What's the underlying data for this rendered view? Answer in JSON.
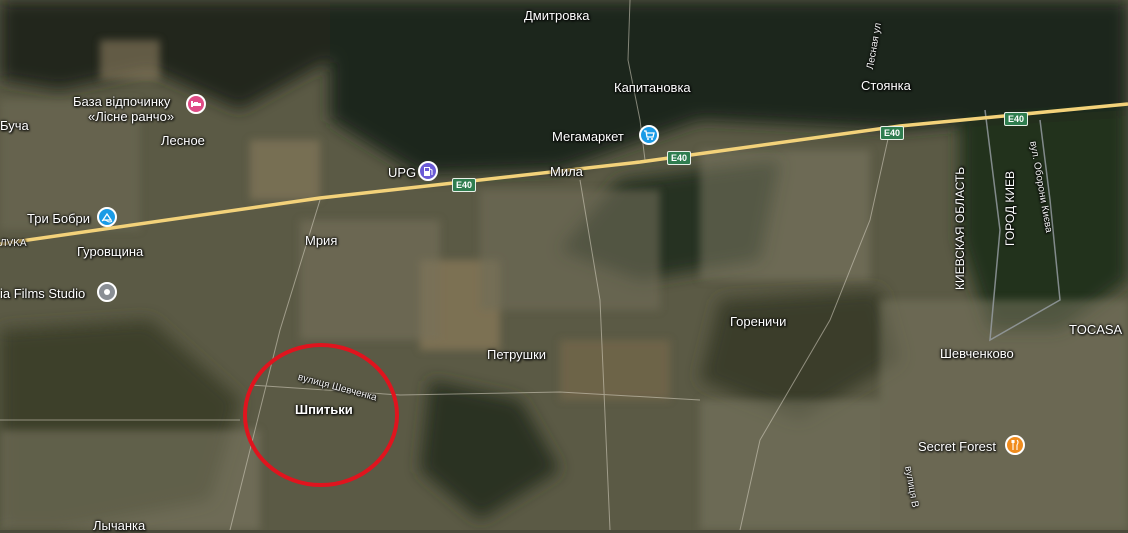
{
  "places": {
    "dmytrivka": "Дмитровка",
    "kapitanovka": "Капитановка",
    "stoyanka": "Стоянка",
    "mila": "Мила",
    "lisne": "Лесное",
    "gurovshchina": "Гуровщина",
    "mriya": "Мрия",
    "petrushki": "Петрушки",
    "gorenichi": "Гореничи",
    "shevchenkovo": "Шевченково",
    "shpitki": "Шпитьки",
    "lichanka": "Лычанка",
    "bucha_partial": "Буча",
    "tocasa": "TOCASA",
    "kiev_oblast": "КИЕВСКАЯ ОБЛАСТЬ",
    "kiev_city": "ГОРОД КИЕВ"
  },
  "pois": {
    "lisne_rancho_line1": "База відпочинку",
    "lisne_rancho_line2": "«Лісне ранчо»",
    "upg": "UPG",
    "megamarket": "Мегамаркет",
    "tri_bobri": "Три Бобри",
    "films_studio": "ia Films Studio",
    "secret_forest": "Secret Forest"
  },
  "roads": {
    "e40_1": "E40",
    "e40_2": "E40",
    "e40_3": "E40",
    "e40_4": "E40",
    "shevchenka": "вулиця Шевченка",
    "lisna": "Лесная ул",
    "oborony": "вул. Оборони Києва",
    "lesi": "вулиця В",
    "edge_left": "ЛVKA"
  },
  "colors": {
    "highway": "#f3d27a",
    "highlight_circle": "#e0141e",
    "pin_lodging": "#e04b86",
    "pin_gas": "#6b5bd6",
    "pin_shop": "#1a9be6",
    "pin_water": "#1a9be6",
    "pin_studio": "#8a8f95",
    "pin_food": "#f08c1e",
    "border_line": "#9aa0a6"
  },
  "icons": {
    "lodging": "bed-icon",
    "gas": "fuel-pump-icon",
    "shop": "shopping-cart-icon",
    "waterpark": "waterpark-icon",
    "studio": "landmark-icon",
    "food": "fork-knife-icon"
  }
}
